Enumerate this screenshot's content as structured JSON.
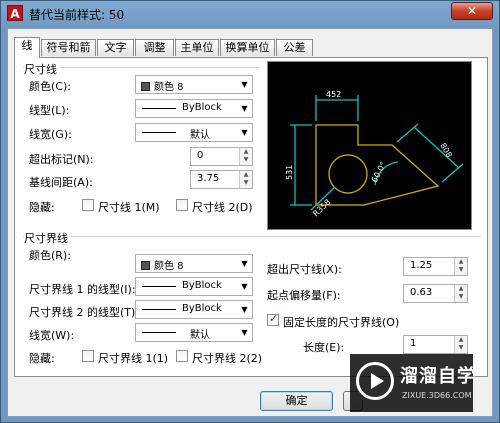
{
  "window": {
    "title": "替代当前样式: 50",
    "app_icon_letter": "A",
    "close_glyph": "✕"
  },
  "tabs": [
    "线",
    "符号和箭头",
    "文字",
    "调整",
    "主单位",
    "换算单位",
    "公差"
  ],
  "dim_line": {
    "group": "尺寸线",
    "color_label": "颜色(C):",
    "color_value": "颜色 8",
    "linetype_label": "线型(L):",
    "linetype_value": "ByBlock",
    "lineweight_label": "线宽(G):",
    "lineweight_value": "默认",
    "extend_label": "超出标记(N):",
    "extend_value": "0",
    "baseline_label": "基线间距(A):",
    "baseline_value": "3.75",
    "suppress_label": "隐藏:",
    "suppress_1": "尺寸线 1(M)",
    "suppress_2": "尺寸线 2(D)"
  },
  "ext_line": {
    "group": "尺寸界线",
    "color_label": "颜色(R):",
    "color_value": "颜色 8",
    "lt1_label": "尺寸界线 1 的线型(I):",
    "lt1_value": "ByBlock",
    "lt2_label": "尺寸界线 2 的线型(T):",
    "lt2_value": "ByBlock",
    "lineweight_label": "线宽(W):",
    "lineweight_value": "默认",
    "suppress_label": "隐藏:",
    "suppress_1": "尺寸界线 1(1)",
    "suppress_2": "尺寸界线 2(2)",
    "extend_label": "超出尺寸线(X):",
    "extend_value": "1.25",
    "offset_label": "起点偏移量(F):",
    "offset_value": "0.63",
    "fixed_label": "固定长度的尺寸界线(O)",
    "fixed_checked": true,
    "length_label": "长度(E):",
    "length_value": "1"
  },
  "preview": {
    "dim_top": "452",
    "dim_left": "531",
    "dim_right": "808",
    "dim_angle": "60.0°",
    "dim_radius": "R358",
    "geometry_color": "#d4b000",
    "dim_color": "#00c8c8"
  },
  "buttons": {
    "ok": "确定"
  },
  "watermark": {
    "brand": "溜溜自学",
    "url": "ZIXUE.3D66.COM"
  }
}
